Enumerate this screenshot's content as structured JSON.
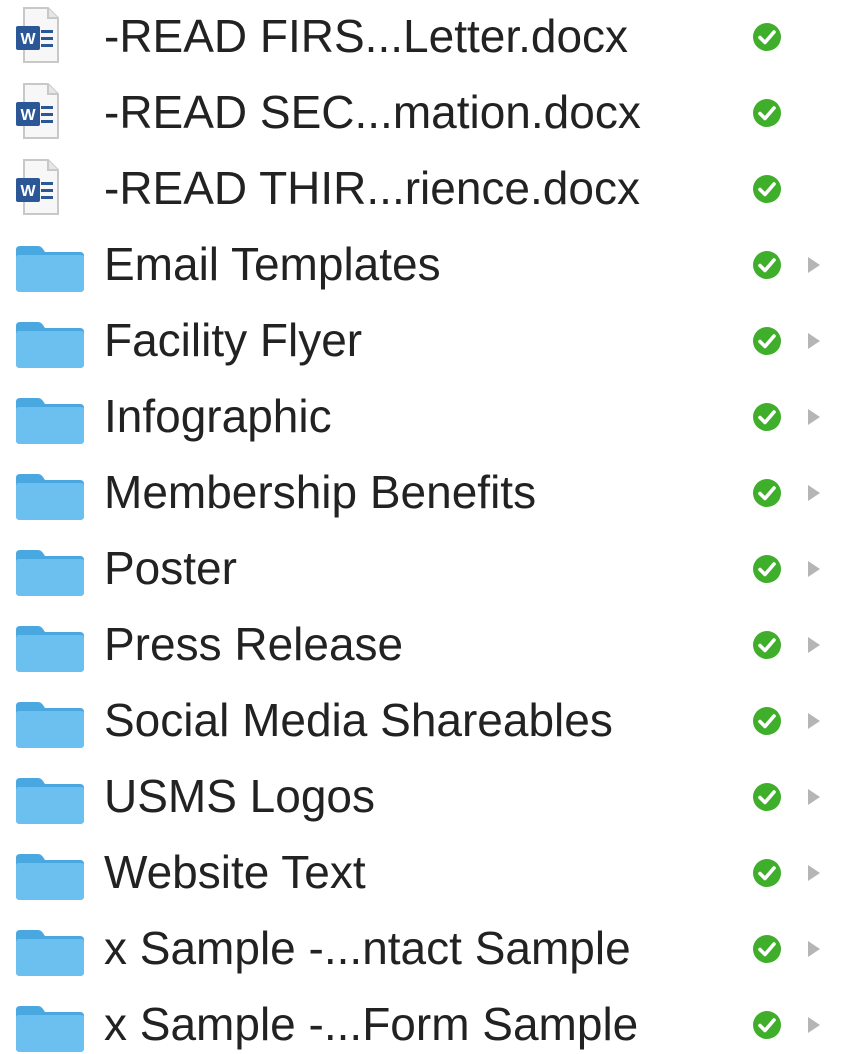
{
  "colors": {
    "text": "#222222",
    "folder": "#5db6e9",
    "status_green": "#3fae2a",
    "word_blue": "#2b5797",
    "disclosure": "#b5b5b5"
  },
  "items": [
    {
      "name": "-READ FIRS...Letter.docx",
      "kind": "word-document",
      "status": "synced-check",
      "expandable": false
    },
    {
      "name": "-READ SEC...mation.docx",
      "kind": "word-document",
      "status": "synced-check",
      "expandable": false
    },
    {
      "name": "-READ THIR...rience.docx",
      "kind": "word-document",
      "status": "synced-check",
      "expandable": false
    },
    {
      "name": "Email Templates",
      "kind": "folder",
      "status": "synced-check",
      "expandable": true
    },
    {
      "name": "Facility Flyer",
      "kind": "folder",
      "status": "synced-check",
      "expandable": true
    },
    {
      "name": "Infographic",
      "kind": "folder",
      "status": "synced-check",
      "expandable": true
    },
    {
      "name": "Membership Benefits",
      "kind": "folder",
      "status": "synced-check",
      "expandable": true
    },
    {
      "name": "Poster",
      "kind": "folder",
      "status": "synced-check",
      "expandable": true
    },
    {
      "name": "Press Release",
      "kind": "folder",
      "status": "synced-check",
      "expandable": true
    },
    {
      "name": "Social Media Shareables",
      "kind": "folder",
      "status": "synced-check",
      "expandable": true
    },
    {
      "name": "USMS Logos",
      "kind": "folder",
      "status": "synced-check",
      "expandable": true
    },
    {
      "name": "Website Text",
      "kind": "folder",
      "status": "synced-check",
      "expandable": true
    },
    {
      "name": "x Sample -...ntact Sample",
      "kind": "folder",
      "status": "synced-check",
      "expandable": true
    },
    {
      "name": "x Sample -...Form Sample",
      "kind": "folder",
      "status": "synced-check",
      "expandable": true
    }
  ]
}
